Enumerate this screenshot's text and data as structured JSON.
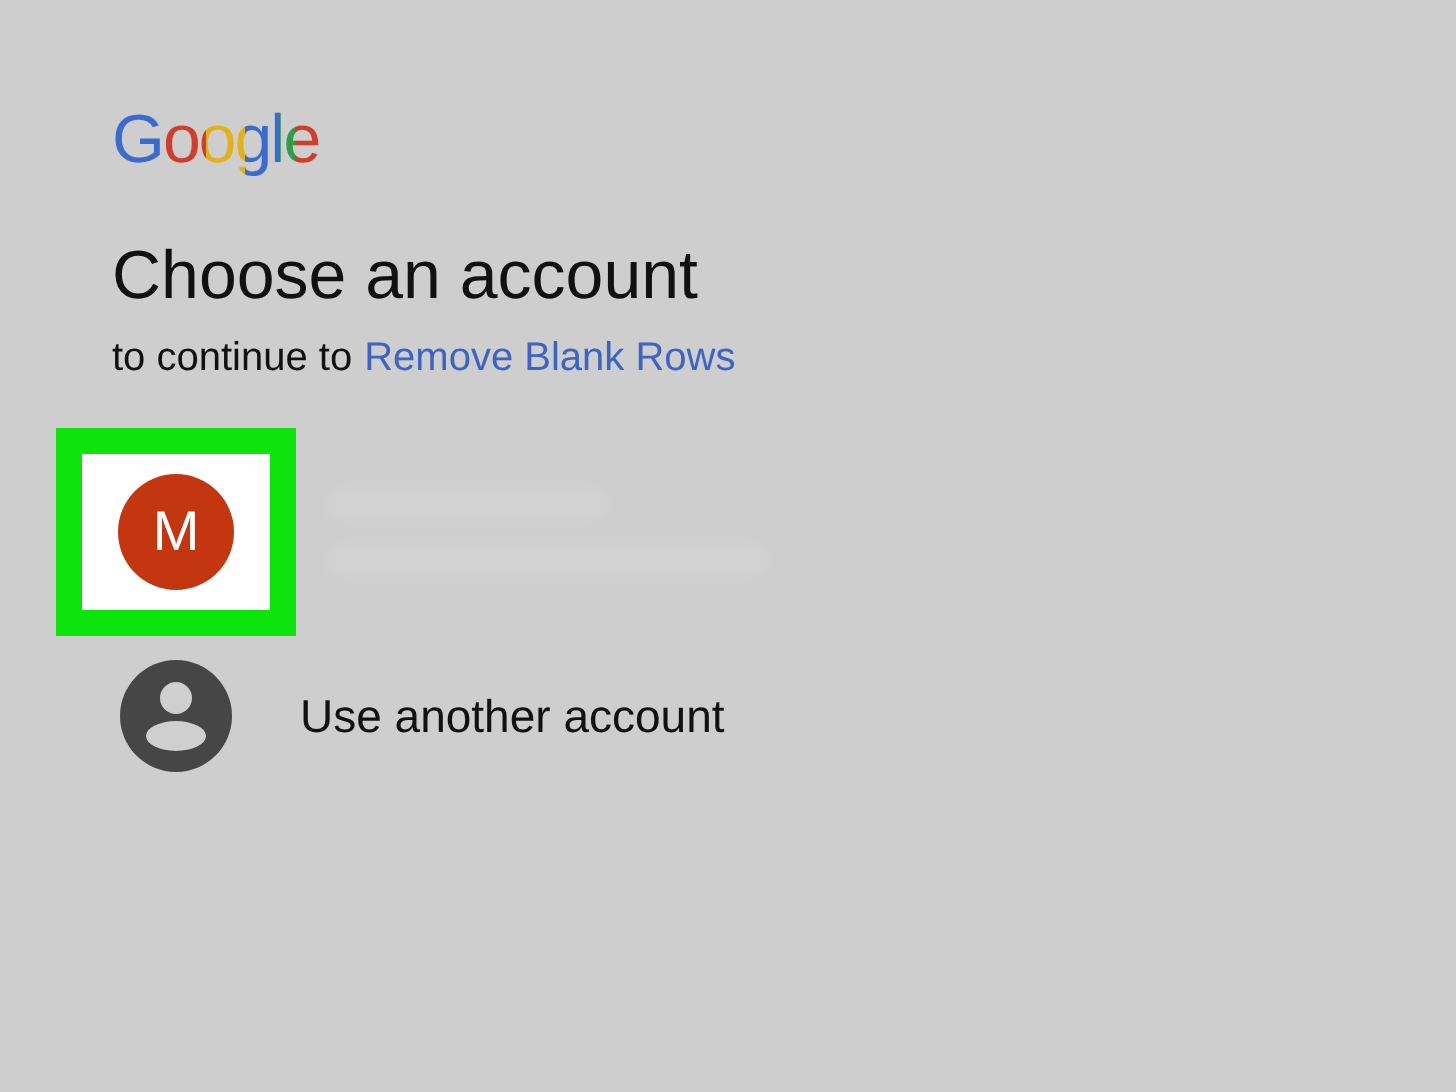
{
  "logo": "Google",
  "heading": "Choose an account",
  "subheading": {
    "text": "to continue to",
    "app_link": "Remove Blank Rows"
  },
  "accounts": [
    {
      "kind": "account",
      "initial": "M",
      "highlighted": true
    },
    {
      "kind": "add",
      "label": "Use another account",
      "highlighted": false
    }
  ]
}
